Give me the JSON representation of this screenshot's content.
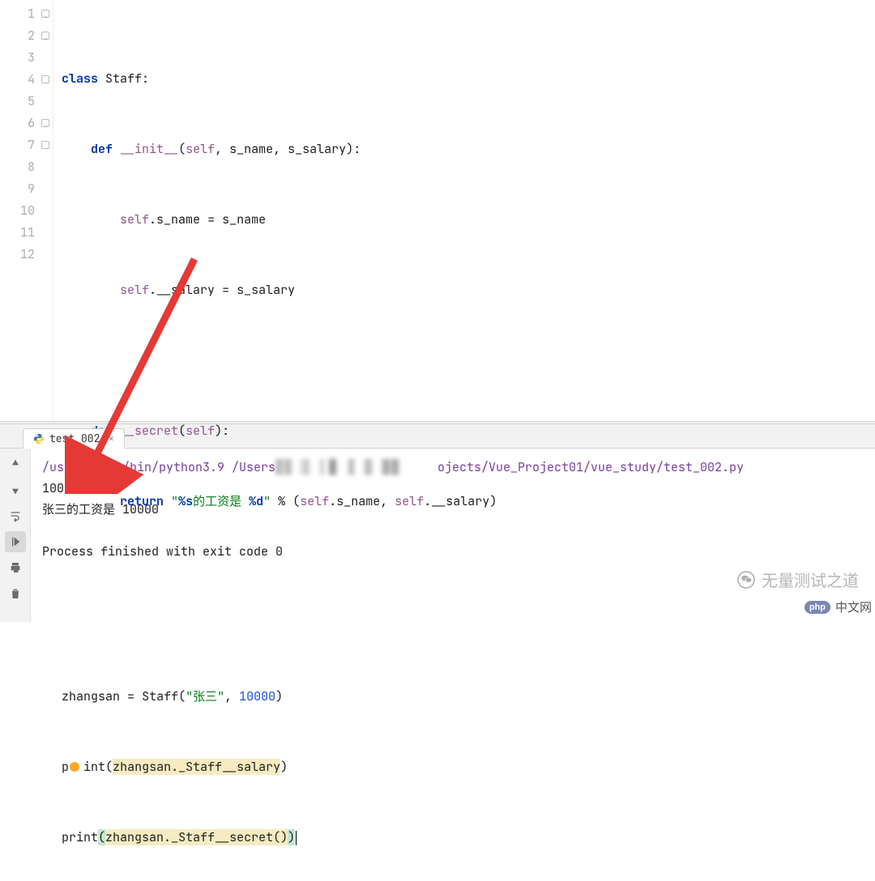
{
  "editor": {
    "lines": {
      "l1": {
        "num": "1",
        "tokens": [
          "class",
          "Staff",
          ":"
        ]
      },
      "l2": {
        "num": "2",
        "tokens": [
          "def",
          "__init__",
          "(",
          "self",
          ",",
          "s_name",
          ",",
          "s_salary",
          ")",
          ":"
        ]
      },
      "l3": {
        "num": "3",
        "tokens": [
          "self",
          ".",
          "s_name",
          "=",
          "s_name"
        ]
      },
      "l4": {
        "num": "4",
        "tokens": [
          "self",
          ".",
          "__salary",
          "=",
          "s_salary"
        ]
      },
      "l5": {
        "num": "5"
      },
      "l6": {
        "num": "6",
        "tokens": [
          "def",
          "__secret",
          "(",
          "self",
          ")",
          ":"
        ]
      },
      "l7": {
        "num": "7",
        "tokens": [
          "return",
          "\"",
          "%s",
          "的工资是 ",
          "%d",
          "\"",
          "%",
          "(",
          "self",
          ".",
          "s_name",
          ",",
          "self",
          ".",
          "__salary",
          ")"
        ]
      },
      "l8": {
        "num": "8"
      },
      "l9": {
        "num": "9"
      },
      "l10": {
        "num": "10",
        "tokens": [
          "zhangsan",
          "=",
          "Staff",
          "(",
          "\"张三\"",
          ",",
          "10000",
          ")"
        ]
      },
      "l11": {
        "num": "11",
        "tokens": [
          "p",
          "int",
          "(",
          "zhangsan",
          ".",
          "_Staff__salary",
          ")"
        ]
      },
      "l12": {
        "num": "12",
        "tokens": [
          "print",
          "(",
          "zhangsan",
          ".",
          "_Staff__secret",
          "(",
          ")",
          ")"
        ]
      }
    }
  },
  "tab": {
    "label": "test_002",
    "close": "×"
  },
  "console": {
    "path_start": "/usr/lo",
    "path_mid": "al/bin/python3.9 /Users",
    "path_end": "ojects/Vue_Project01/vue_study/test_002.py",
    "out1": "10000",
    "out2": "张三的工资是 10000",
    "exit": "Process finished with exit code 0"
  },
  "watermark": {
    "text": "无量测试之道",
    "badge": "php",
    "site": "中文网"
  }
}
